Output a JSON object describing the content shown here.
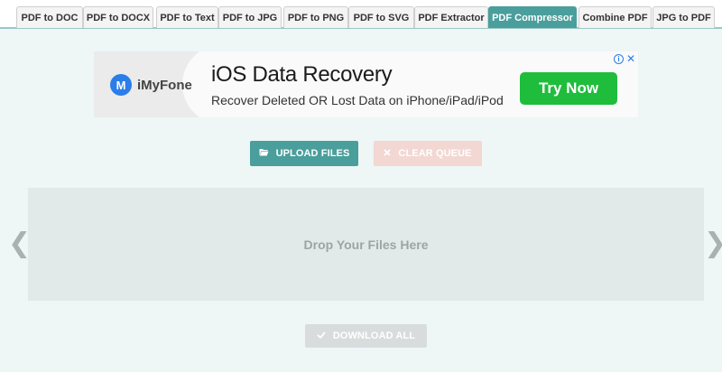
{
  "tabs": [
    {
      "label": "PDF to DOC"
    },
    {
      "label": "PDF to DOCX"
    },
    {
      "label": "PDF to Text"
    },
    {
      "label": "PDF to JPG"
    },
    {
      "label": "PDF to PNG"
    },
    {
      "label": "PDF to SVG"
    },
    {
      "label": "PDF Extractor"
    },
    {
      "label": "PDF Compressor",
      "active": true
    },
    {
      "label": "Combine PDF"
    },
    {
      "label": "JPG to PDF"
    }
  ],
  "ad": {
    "brand": "iMyFone",
    "logo_letter": "M",
    "title": "iOS Data Recovery",
    "subtitle": "Recover Deleted OR Lost Data on iPhone/iPad/iPod",
    "cta": "Try Now",
    "info_icon": "info-icon",
    "close_icon": "close-icon",
    "info_glyph": "i",
    "close_glyph": "✕"
  },
  "actions": {
    "upload_label": "UPLOAD FILES",
    "upload_icon": "folder-open-icon",
    "clear_label": "CLEAR QUEUE",
    "clear_icon": "close-icon",
    "download_label": "DOWNLOAD ALL",
    "download_icon": "check-icon"
  },
  "dropzone": {
    "text": "Drop Your Files Here"
  },
  "carousel": {
    "prev_glyph": "❮",
    "next_glyph": "❯"
  },
  "colors": {
    "accent": "#4a9e9c",
    "ad_cta": "#1fbd3c",
    "clear_button": "#f3d7d2",
    "download_button_disabled": "#d9dcdc"
  }
}
